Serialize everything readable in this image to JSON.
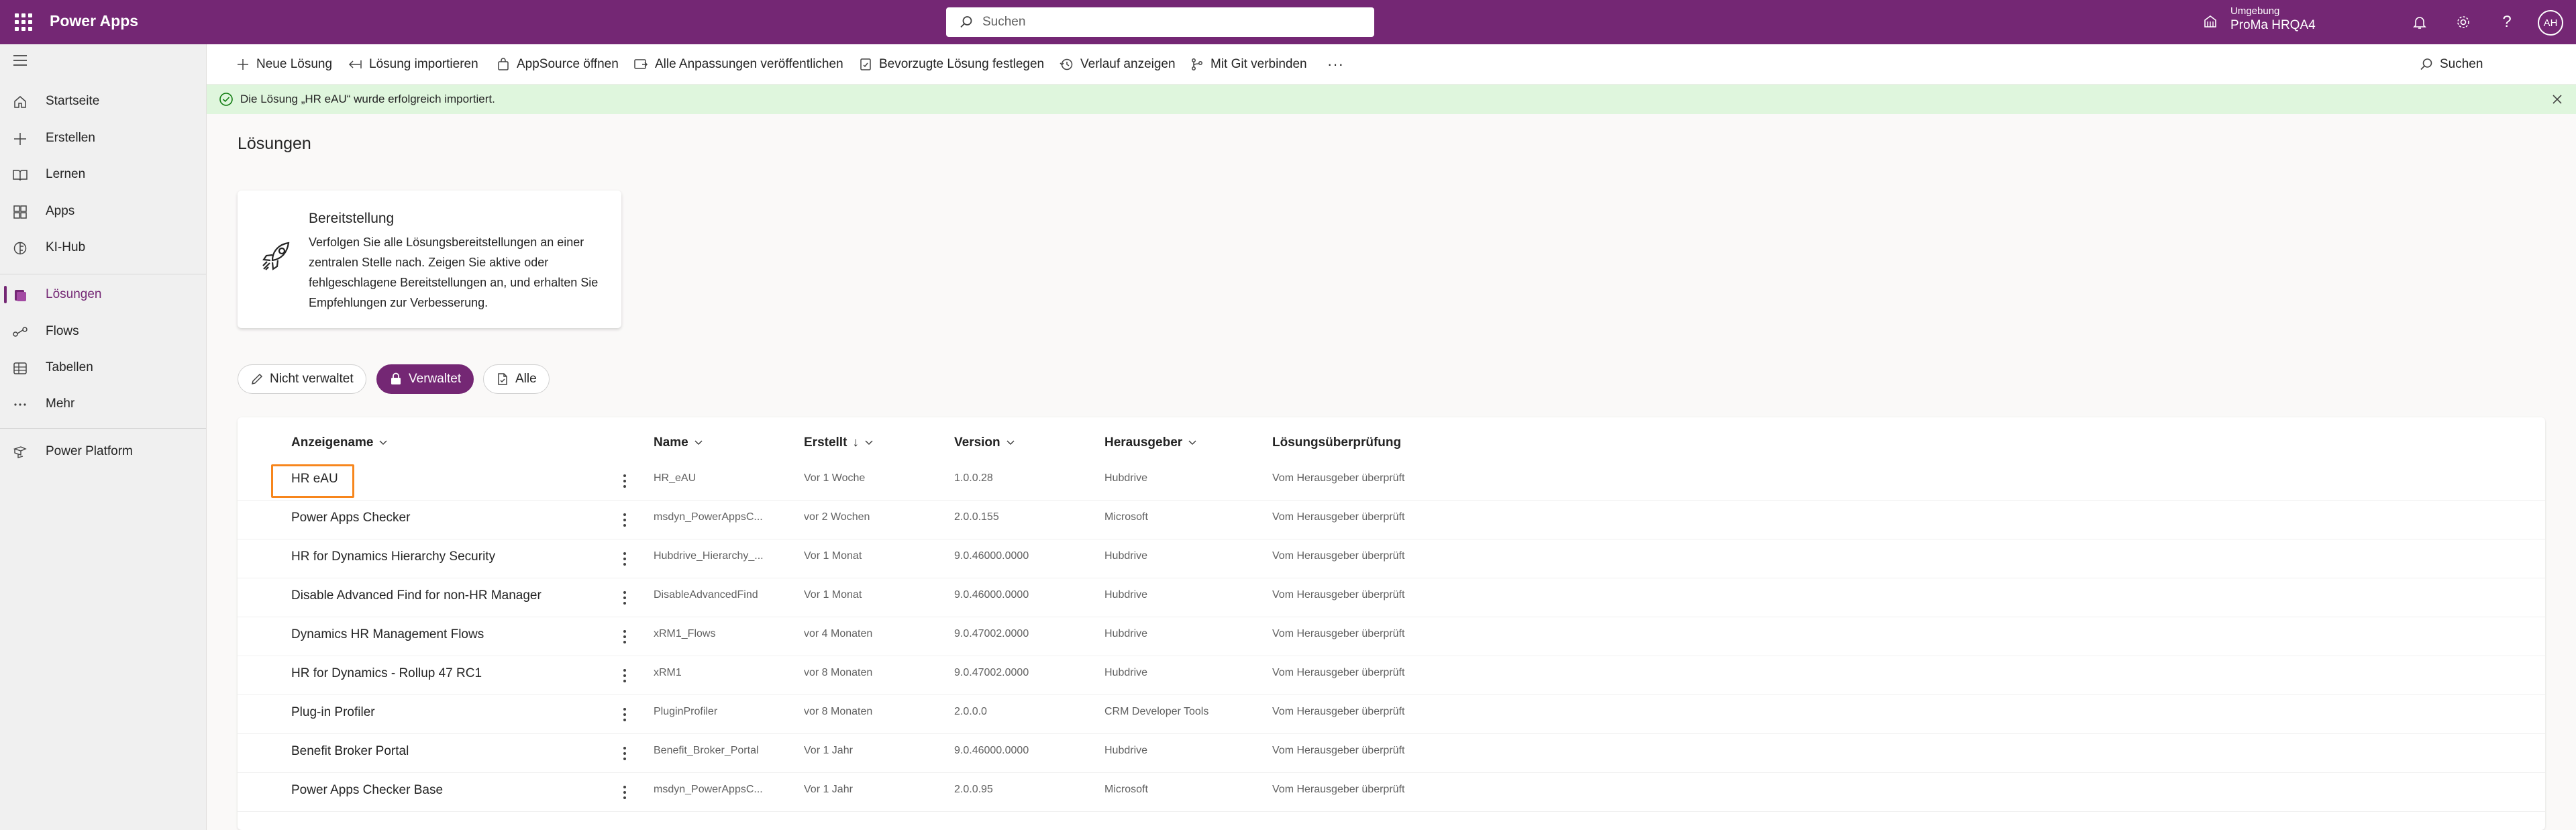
{
  "header": {
    "app_title": "Power Apps",
    "search_placeholder": "Suchen",
    "env_label": "Umgebung",
    "env_name": "ProMa HRQA4",
    "avatar_initials": "AH",
    "brand_color": "#742774"
  },
  "sidebar": {
    "items": [
      {
        "label": "Startseite",
        "icon": "home-icon"
      },
      {
        "label": "Erstellen",
        "icon": "plus-icon"
      },
      {
        "label": "Lernen",
        "icon": "book-icon"
      },
      {
        "label": "Apps",
        "icon": "apps-icon"
      },
      {
        "label": "KI-Hub",
        "icon": "brain-icon"
      },
      {
        "label": "Lösungen",
        "icon": "solutions-icon",
        "active": true
      },
      {
        "label": "Flows",
        "icon": "flow-icon"
      },
      {
        "label": "Tabellen",
        "icon": "table-icon"
      },
      {
        "label": "Mehr",
        "icon": "more-icon"
      },
      {
        "label": "Power Platform",
        "icon": "power-platform-icon"
      }
    ]
  },
  "commandbar": {
    "new_solution": "Neue Lösung",
    "import_solution": "Lösung importieren",
    "appsource": "AppSource öffnen",
    "publish_all": "Alle Anpassungen veröffentlichen",
    "preferred_solution": "Bevorzugte Lösung festlegen",
    "show_history": "Verlauf anzeigen",
    "connect_git": "Mit Git verbinden",
    "overflow": "···",
    "search": "Suchen"
  },
  "notification": {
    "text": "Die Lösung „HR eAU“ wurde erfolgreich importiert.",
    "status_color": "#dff6dd"
  },
  "main": {
    "title": "Lösungen",
    "card": {
      "title": "Bereitstellung",
      "body": "Verfolgen Sie alle Lösungsbereitstellungen an einer zentralen Stelle nach. Zeigen Sie aktive oder fehlgeschlagene Bereitstellungen an, und erhalten Sie Empfehlungen zur Verbesserung."
    },
    "filters": [
      {
        "label": "Nicht verwaltet",
        "icon": "pencil-icon",
        "selected": false
      },
      {
        "label": "Verwaltet",
        "icon": "lock-icon",
        "selected": true
      },
      {
        "label": "Alle",
        "icon": "document-icon",
        "selected": false
      }
    ]
  },
  "grid": {
    "columns": [
      "Anzeigename",
      "Name",
      "Erstellt",
      "Version",
      "Herausgeber",
      "Lösungsüberprüfung"
    ],
    "sort_indicator": "↓",
    "rows": [
      {
        "display": "HR eAU",
        "name": "HR_eAU",
        "created": "Vor 1 Woche",
        "version": "1.0.0.28",
        "publisher": "Hubdrive",
        "check": "Vom Herausgeber überprüft"
      },
      {
        "display": "Power Apps Checker",
        "name": "msdyn_PowerAppsC...",
        "created": "vor 2 Wochen",
        "version": "2.0.0.155",
        "publisher": "Microsoft",
        "check": "Vom Herausgeber überprüft"
      },
      {
        "display": "HR for Dynamics Hierarchy Security",
        "name": "Hubdrive_Hierarchy_...",
        "created": "Vor 1 Monat",
        "version": "9.0.46000.0000",
        "publisher": "Hubdrive",
        "check": "Vom Herausgeber überprüft"
      },
      {
        "display": "Disable Advanced Find for non-HR Manager",
        "name": "DisableAdvancedFind",
        "created": "Vor 1 Monat",
        "version": "9.0.46000.0000",
        "publisher": "Hubdrive",
        "check": "Vom Herausgeber überprüft"
      },
      {
        "display": "Dynamics HR Management Flows",
        "name": "xRM1_Flows",
        "created": "vor 4 Monaten",
        "version": "9.0.47002.0000",
        "publisher": "Hubdrive",
        "check": "Vom Herausgeber überprüft"
      },
      {
        "display": "HR for Dynamics - Rollup 47 RC1",
        "name": "xRM1",
        "created": "vor 8 Monaten",
        "version": "9.0.47002.0000",
        "publisher": "Hubdrive",
        "check": "Vom Herausgeber überprüft"
      },
      {
        "display": "Plug-in Profiler",
        "name": "PluginProfiler",
        "created": "vor 8 Monaten",
        "version": "2.0.0.0",
        "publisher": "CRM Developer Tools",
        "check": "Vom Herausgeber überprüft"
      },
      {
        "display": "Benefit Broker Portal",
        "name": "Benefit_Broker_Portal",
        "created": "Vor 1 Jahr",
        "version": "9.0.46000.0000",
        "publisher": "Hubdrive",
        "check": "Vom Herausgeber überprüft"
      },
      {
        "display": "Power Apps Checker Base",
        "name": "msdyn_PowerAppsC...",
        "created": "Vor 1 Jahr",
        "version": "2.0.0.95",
        "publisher": "Microsoft",
        "check": "Vom Herausgeber überprüft"
      }
    ],
    "highlight_color": "#f7861c"
  }
}
